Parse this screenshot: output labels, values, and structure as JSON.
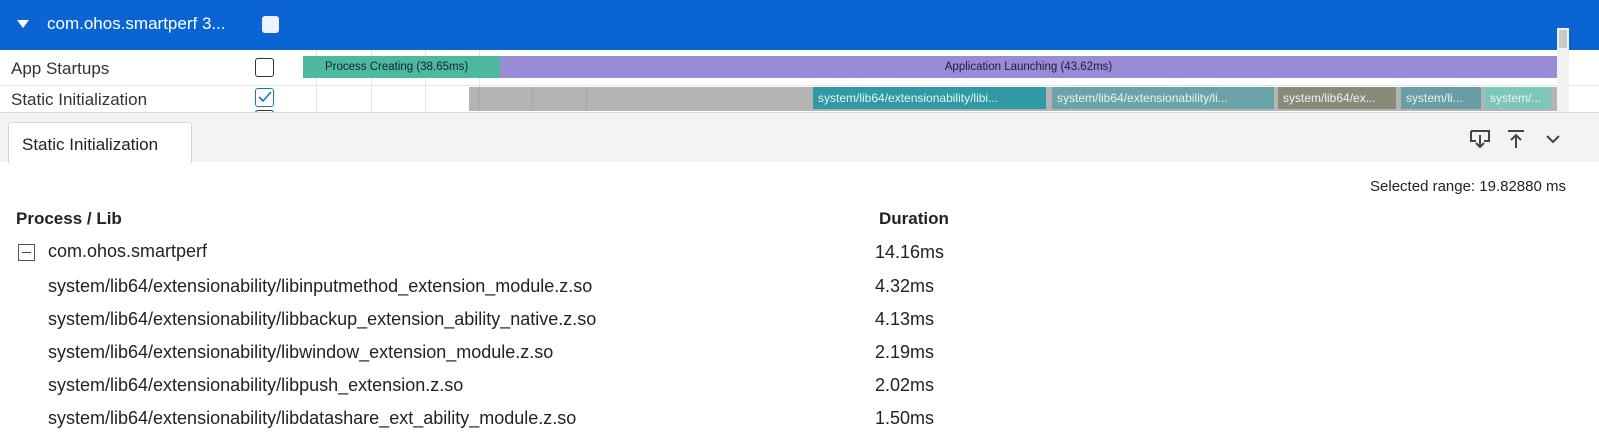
{
  "header": {
    "title": "com.ohos.smartperf 3..."
  },
  "rows": [
    {
      "label": "App Startups",
      "checked": false
    },
    {
      "label": "Static Initialization",
      "checked": true
    }
  ],
  "app_startup_bars": [
    {
      "label": "Process Creating (38.65ms)",
      "color": "#4cb8a0"
    },
    {
      "label": "Application Launching (43.62ms)",
      "color": "#9a8bd6"
    }
  ],
  "static_init_segments": [
    {
      "label": "system/lib64/extensionability/libi...",
      "color": "#2f9aa3"
    },
    {
      "label": "system/lib64/extensionability/li...",
      "color": "#6aa3a8"
    },
    {
      "label": "system/lib64/ex...",
      "color": "#8a8a78"
    },
    {
      "label": "system/li...",
      "color": "#6a9ea6"
    },
    {
      "label": "system/...",
      "color": "#7cc7b9"
    }
  ],
  "tabs": [
    {
      "label": "Static Initialization"
    }
  ],
  "toolbar": {
    "icons": [
      "download-icon",
      "pin-top-icon",
      "chevron-down-icon"
    ]
  },
  "selected_range": "Selected range: 19.82880 ms",
  "table": {
    "columns": [
      "Process / Lib",
      "Duration"
    ],
    "root": {
      "name": "com.ohos.smartperf",
      "duration": "14.16ms"
    },
    "children": [
      {
        "name": "system/lib64/extensionability/libinputmethod_extension_module.z.so",
        "duration": "4.32ms"
      },
      {
        "name": "system/lib64/extensionability/libbackup_extension_ability_native.z.so",
        "duration": "4.13ms"
      },
      {
        "name": "system/lib64/extensionability/libwindow_extension_module.z.so",
        "duration": "2.19ms"
      },
      {
        "name": "system/lib64/extensionability/libpush_extension.z.so",
        "duration": "2.02ms"
      },
      {
        "name": "system/lib64/extensionability/libdatashare_ext_ability_module.z.so",
        "duration": "1.50ms"
      }
    ]
  },
  "colors": {
    "header_bg": "#0a64d4",
    "process_creating": "#4cb8a0",
    "application_launching": "#9a8bd6",
    "static_init_track": "#b4b4b4"
  }
}
